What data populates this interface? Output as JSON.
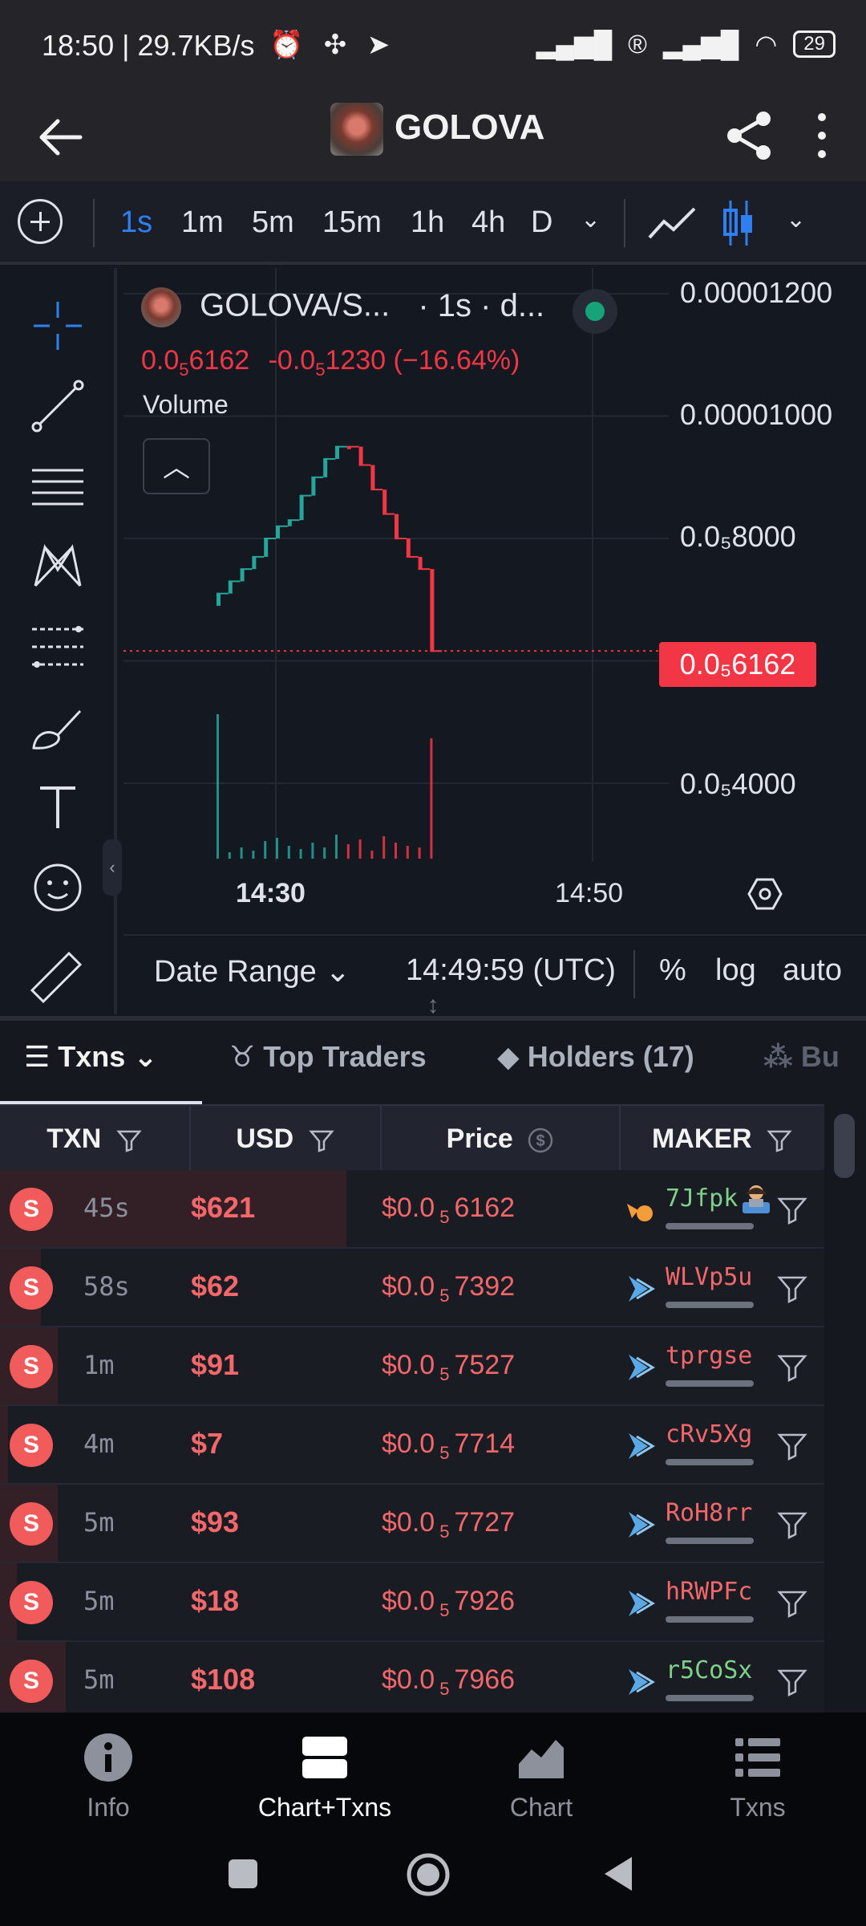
{
  "status_bar": {
    "time": "18:50 | 29.7KB/s",
    "battery": "29"
  },
  "app": {
    "title": "GOLOVA"
  },
  "toolbar": {
    "timeframes": [
      "1s",
      "1m",
      "5m",
      "15m",
      "1h",
      "4h",
      "D"
    ],
    "active_timeframe": "1s"
  },
  "chart": {
    "legend_symbol": "GOLOVA/S...",
    "legend_interval": "· 1s · d...",
    "legend_price_main": "0.0",
    "legend_price_sub": "5",
    "legend_price_rest": "6162",
    "legend_change_main": "-0.0",
    "legend_change_sub": "5",
    "legend_change_rest": "1230 (−16.64%)",
    "volume_label": "Volume",
    "y_labels": [
      "0.00001200",
      "0.00001000",
      "0.0₅8000",
      "0.0₅4000"
    ],
    "price_tag": "0.0₅6162",
    "x_labels": [
      "14:30",
      "14:50"
    ],
    "date_range": "Date Range",
    "time_utc": "14:49:59 (UTC)",
    "opt_percent": "%",
    "opt_log": "log",
    "opt_auto": "auto"
  },
  "chart_data": {
    "type": "candlestick",
    "candles": [
      {
        "close": 7.1e-06,
        "dir": "up"
      },
      {
        "close": 7.3e-06,
        "dir": "up"
      },
      {
        "close": 7.5e-06,
        "dir": "up"
      },
      {
        "close": 7.7e-06,
        "dir": "up"
      },
      {
        "close": 8e-06,
        "dir": "up"
      },
      {
        "close": 8.2e-06,
        "dir": "up"
      },
      {
        "close": 8.3e-06,
        "dir": "up"
      },
      {
        "close": 8.7e-06,
        "dir": "up"
      },
      {
        "close": 9e-06,
        "dir": "up"
      },
      {
        "close": 9.3e-06,
        "dir": "up"
      },
      {
        "close": 9.5e-06,
        "dir": "up"
      },
      {
        "close": 9.5e-06,
        "dir": "down"
      },
      {
        "close": 9.2e-06,
        "dir": "down"
      },
      {
        "close": 8.8e-06,
        "dir": "down"
      },
      {
        "close": 8.4e-06,
        "dir": "down"
      },
      {
        "close": 8e-06,
        "dir": "down"
      },
      {
        "close": 7.7e-06,
        "dir": "down"
      },
      {
        "close": 7.5e-06,
        "dir": "down"
      },
      {
        "close": 6.16e-06,
        "dir": "down"
      }
    ],
    "last_price": 6.162e-06
  },
  "tabs": [
    {
      "label": "Txns",
      "active": true
    },
    {
      "label": "Top Traders",
      "active": false
    },
    {
      "label": "Holders (17)",
      "active": false
    },
    {
      "label": "Bu",
      "active": false
    }
  ],
  "table": {
    "headers": [
      "TXN",
      "USD",
      "Price",
      "MAKER"
    ],
    "rows": [
      {
        "type": "S",
        "age": "45s",
        "usd": "$621",
        "price_main": "$0.0",
        "price_sub": "5",
        "price_rest": "6162",
        "maker": "7Jfpk",
        "maker_color": "green",
        "icon": "orange-swap-icon",
        "dev": true,
        "shade": 0.42
      },
      {
        "type": "S",
        "age": "58s",
        "usd": "$62",
        "price_main": "$0.0",
        "price_sub": "5",
        "price_rest": "7392",
        "maker": "WLVp5u",
        "maker_color": "red",
        "icon": "blue-arrow-icon",
        "dev": false,
        "shade": 0.05
      },
      {
        "type": "S",
        "age": "1m",
        "usd": "$91",
        "price_main": "$0.0",
        "price_sub": "5",
        "price_rest": "7527",
        "maker": "tprgse",
        "maker_color": "red",
        "icon": "blue-arrow-icon",
        "dev": false,
        "shade": 0.07
      },
      {
        "type": "S",
        "age": "4m",
        "usd": "$7",
        "price_main": "$0.0",
        "price_sub": "5",
        "price_rest": "7714",
        "maker": "cRv5Xg",
        "maker_color": "red",
        "icon": "blue-arrow-icon",
        "dev": false,
        "shade": 0.01
      },
      {
        "type": "S",
        "age": "5m",
        "usd": "$93",
        "price_main": "$0.0",
        "price_sub": "5",
        "price_rest": "7727",
        "maker": "RoH8rr",
        "maker_color": "red",
        "icon": "blue-arrow-icon",
        "dev": false,
        "shade": 0.07
      },
      {
        "type": "S",
        "age": "5m",
        "usd": "$18",
        "price_main": "$0.0",
        "price_sub": "5",
        "price_rest": "7926",
        "maker": "hRWPFc",
        "maker_color": "red",
        "icon": "blue-arrow-icon",
        "dev": false,
        "shade": 0.02
      },
      {
        "type": "S",
        "age": "5m",
        "usd": "$108",
        "price_main": "$0.0",
        "price_sub": "5",
        "price_rest": "7966",
        "maker": "r5CoSx",
        "maker_color": "green",
        "icon": "blue-arrow-icon",
        "dev": false,
        "shade": 0.08
      }
    ]
  },
  "bottom_nav": [
    {
      "label": "Info",
      "icon": "info-icon",
      "active": false
    },
    {
      "label": "Chart+Txns",
      "icon": "split-view-icon",
      "active": true
    },
    {
      "label": "Chart",
      "icon": "chart-icon",
      "active": false
    },
    {
      "label": "Txns",
      "icon": "list-icon",
      "active": false
    }
  ],
  "colors": {
    "up": "#26a69a",
    "down": "#f23645",
    "accent": "#2f7ff2"
  }
}
